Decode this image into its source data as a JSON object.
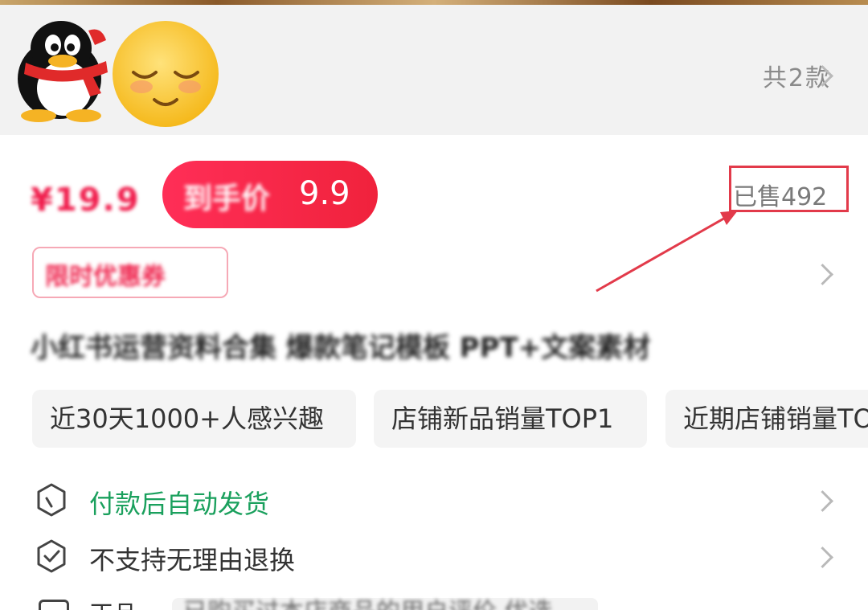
{
  "gallery": {
    "thumbnails": [
      {
        "icon": "penguin-mascot-icon"
      },
      {
        "icon": "blushing-smiley-icon"
      }
    ],
    "count_label": "共2款"
  },
  "price": {
    "original_masked": "¥19.9",
    "promo_masked": "到手价",
    "promo_suffix": "9.9",
    "sold_label": "已售492"
  },
  "coupon": {
    "masked_text": "限时优惠券"
  },
  "product": {
    "title_masked": "小红书运营资料合集 爆款笔记模板 PPT+文案素材"
  },
  "tags": [
    "近30天1000+人感兴趣",
    "店铺新品销量TOP1",
    "近期店铺销量TOP"
  ],
  "services": [
    {
      "label": "付款后自动发货",
      "icon": "box-icon",
      "color": "#1aa05d"
    },
    {
      "label": "不支持无理由退换",
      "icon": "shield-check-icon",
      "color": "#333333"
    }
  ],
  "extra": {
    "label_prefix": "正品",
    "masked_text": "已购买过本店商品的用户评价 优选"
  },
  "colors": {
    "accent": "#f01e4d",
    "green": "#1aa05d",
    "annotation": "#e23a4a"
  }
}
